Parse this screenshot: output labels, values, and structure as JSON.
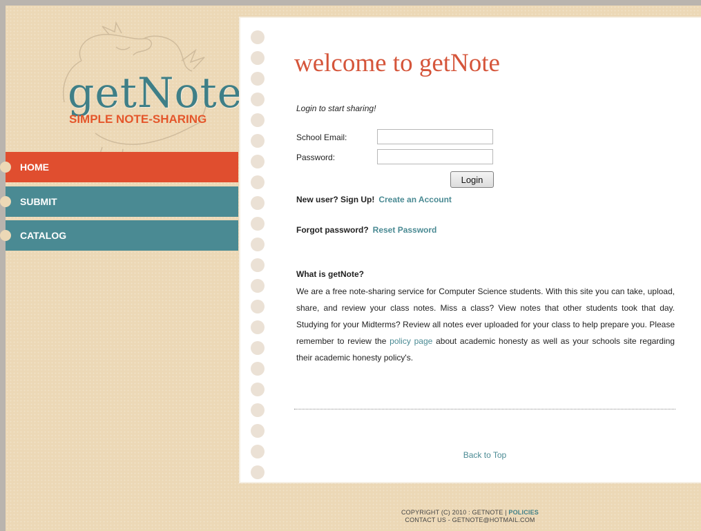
{
  "logo": {
    "title": "getNote",
    "tagline": "SIMPLE NOTE-SHARING"
  },
  "nav": {
    "items": [
      {
        "label": "HOME",
        "active": true
      },
      {
        "label": "SUBMIT",
        "active": false
      },
      {
        "label": "CATALOG",
        "active": false
      }
    ]
  },
  "main": {
    "title": "welcome to getNote",
    "login_prompt": "Login to start sharing!",
    "email_label": "School Email:",
    "email_value": "",
    "password_label": "Password:",
    "password_value": "",
    "login_button": "Login",
    "signup_text": "New user? Sign Up!",
    "signup_link": "Create an Account",
    "forgot_text": "Forgot password?",
    "forgot_link": "Reset Password",
    "about_heading": "What is getNote?",
    "about_before_link": "We are a free note-sharing service for Computer Science students. With this site you can take, upload, share, and review your class notes. Miss a class? View notes that other students took that day. Studying for your Midterms? Review all notes ever uploaded for your class to help prepare you. Please remember to review the ",
    "about_link": "policy page",
    "about_after_link": " about academic honesty as well as your schools site regarding their academic honesty policy's.",
    "back_to_top": "Back to Top"
  },
  "footer": {
    "copyright": "COPYRIGHT (C) 2010 : GETNOTE |",
    "policies_link": "POLICIES",
    "contact": "CONTACT US - GETNOTE@HOTMAIL.COM"
  },
  "colors": {
    "accent_red": "#e04e2f",
    "nav_teal": "#4a8a93",
    "title_red": "#d5553a",
    "link_teal": "#4a8a93",
    "background_tan": "#ecd8b6"
  },
  "icons": {
    "logo_graphic": "dragon-sketch-icon",
    "nav_bullet": "hole-punch-icon",
    "paper_rings": "notebook-ring-icon"
  }
}
